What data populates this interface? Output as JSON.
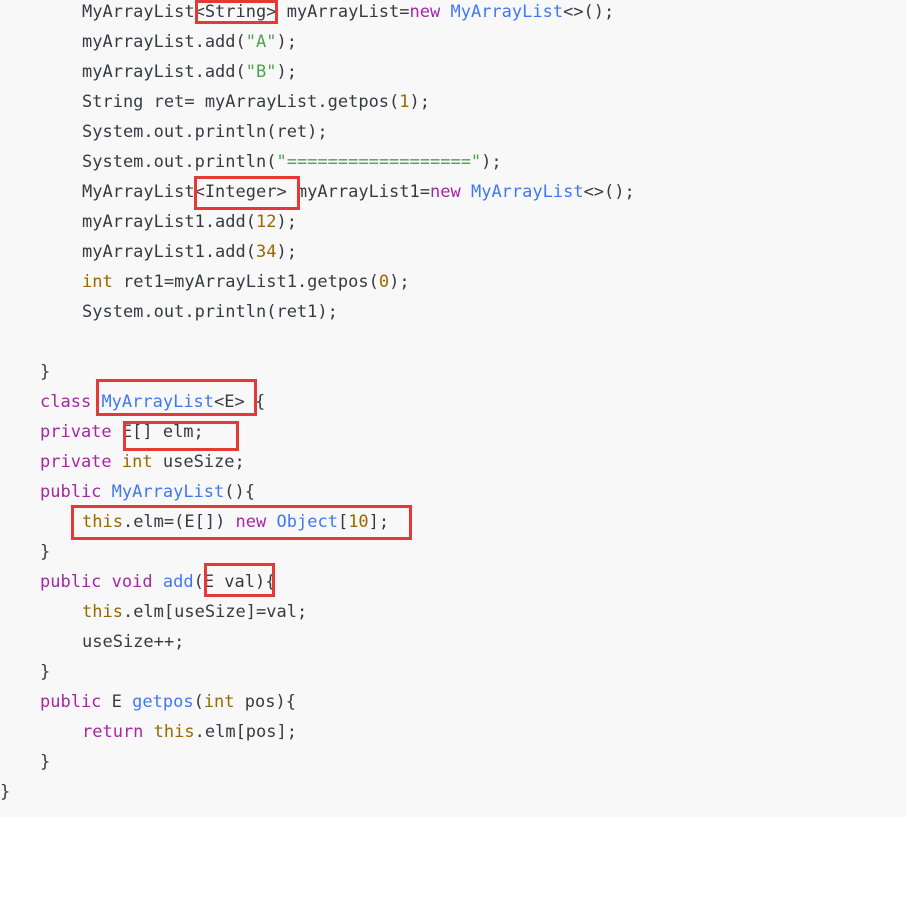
{
  "code": {
    "lines": [
      [
        {
          "t": "MyArrayList<String> myArrayList=",
          "c": "plain"
        },
        {
          "t": "new",
          "c": "kw"
        },
        {
          "t": " ",
          "c": "plain"
        },
        {
          "t": "MyArrayList",
          "c": "cls"
        },
        {
          "t": "<>();",
          "c": "plain"
        }
      ],
      [
        {
          "t": "myArrayList.add(",
          "c": "plain"
        },
        {
          "t": "\"A\"",
          "c": "str"
        },
        {
          "t": ");",
          "c": "plain"
        }
      ],
      [
        {
          "t": "myArrayList.add(",
          "c": "plain"
        },
        {
          "t": "\"B\"",
          "c": "str"
        },
        {
          "t": ");",
          "c": "plain"
        }
      ],
      [
        {
          "t": "String ret= myArrayList.getpos(",
          "c": "plain"
        },
        {
          "t": "1",
          "c": "num"
        },
        {
          "t": ");",
          "c": "plain"
        }
      ],
      [
        {
          "t": "System.out.println(ret);",
          "c": "plain"
        }
      ],
      [
        {
          "t": "System.out.println(",
          "c": "plain"
        },
        {
          "t": "\"==================\"",
          "c": "str"
        },
        {
          "t": ");",
          "c": "plain"
        }
      ],
      [
        {
          "t": "MyArrayList<Integer> myArrayList1=",
          "c": "plain"
        },
        {
          "t": "new",
          "c": "kw"
        },
        {
          "t": " ",
          "c": "plain"
        },
        {
          "t": "MyArrayList",
          "c": "cls"
        },
        {
          "t": "<>();",
          "c": "plain"
        }
      ],
      [
        {
          "t": "myArrayList1.add(",
          "c": "plain"
        },
        {
          "t": "12",
          "c": "num"
        },
        {
          "t": ");",
          "c": "plain"
        }
      ],
      [
        {
          "t": "myArrayList1.add(",
          "c": "plain"
        },
        {
          "t": "34",
          "c": "num"
        },
        {
          "t": ");",
          "c": "plain"
        }
      ],
      [
        {
          "t": "int",
          "c": "ty"
        },
        {
          "t": " ret1=myArrayList1.getpos(",
          "c": "plain"
        },
        {
          "t": "0",
          "c": "num"
        },
        {
          "t": ");",
          "c": "plain"
        }
      ],
      [
        {
          "t": "System.out.println(ret1);",
          "c": "plain"
        }
      ],
      [],
      [
        {
          "t": "}",
          "c": "plain"
        }
      ],
      [
        {
          "t": "class",
          "c": "kw"
        },
        {
          "t": " ",
          "c": "plain"
        },
        {
          "t": "MyArrayList",
          "c": "cls"
        },
        {
          "t": "<E> {",
          "c": "plain"
        }
      ],
      [
        {
          "t": "private",
          "c": "kw"
        },
        {
          "t": " E[] elm;",
          "c": "plain"
        }
      ],
      [
        {
          "t": "private",
          "c": "kw"
        },
        {
          "t": " ",
          "c": "plain"
        },
        {
          "t": "int",
          "c": "ty"
        },
        {
          "t": " useSize;",
          "c": "plain"
        }
      ],
      [
        {
          "t": "public",
          "c": "kw"
        },
        {
          "t": " ",
          "c": "plain"
        },
        {
          "t": "MyArrayList",
          "c": "cls"
        },
        {
          "t": "(){",
          "c": "plain"
        }
      ],
      [
        {
          "t": "this",
          "c": "ty"
        },
        {
          "t": ".elm=(E[]) ",
          "c": "plain"
        },
        {
          "t": "new",
          "c": "kw"
        },
        {
          "t": " ",
          "c": "plain"
        },
        {
          "t": "Object",
          "c": "cls"
        },
        {
          "t": "[",
          "c": "plain"
        },
        {
          "t": "10",
          "c": "num"
        },
        {
          "t": "];",
          "c": "plain"
        }
      ],
      [
        {
          "t": "}",
          "c": "plain"
        }
      ],
      [
        {
          "t": "public",
          "c": "kw"
        },
        {
          "t": " ",
          "c": "plain"
        },
        {
          "t": "void",
          "c": "kw"
        },
        {
          "t": " ",
          "c": "plain"
        },
        {
          "t": "add",
          "c": "cls"
        },
        {
          "t": "(E val){",
          "c": "plain"
        }
      ],
      [
        {
          "t": "this",
          "c": "ty"
        },
        {
          "t": ".elm[useSize]=val;",
          "c": "plain"
        }
      ],
      [
        {
          "t": "useSize++;",
          "c": "plain"
        }
      ],
      [
        {
          "t": "}",
          "c": "plain"
        }
      ],
      [
        {
          "t": "public",
          "c": "kw"
        },
        {
          "t": " E ",
          "c": "plain"
        },
        {
          "t": "getpos",
          "c": "cls"
        },
        {
          "t": "(",
          "c": "plain"
        },
        {
          "t": "int",
          "c": "ty"
        },
        {
          "t": " pos){",
          "c": "plain"
        }
      ],
      [
        {
          "t": "return",
          "c": "kw"
        },
        {
          "t": " ",
          "c": "plain"
        },
        {
          "t": "this",
          "c": "ty"
        },
        {
          "t": ".elm[pos];",
          "c": "plain"
        }
      ],
      [
        {
          "t": "}",
          "c": "plain"
        }
      ],
      [
        {
          "t": "}",
          "c": "plain"
        }
      ]
    ]
  },
  "colors": {
    "keyword": "#a626a4",
    "type": "#986801",
    "class": "#4078f2",
    "string": "#50a14f",
    "number": "#986801",
    "text": "#383a42",
    "highlight_box": "#e53935",
    "code_background": "#f8f8f8"
  }
}
